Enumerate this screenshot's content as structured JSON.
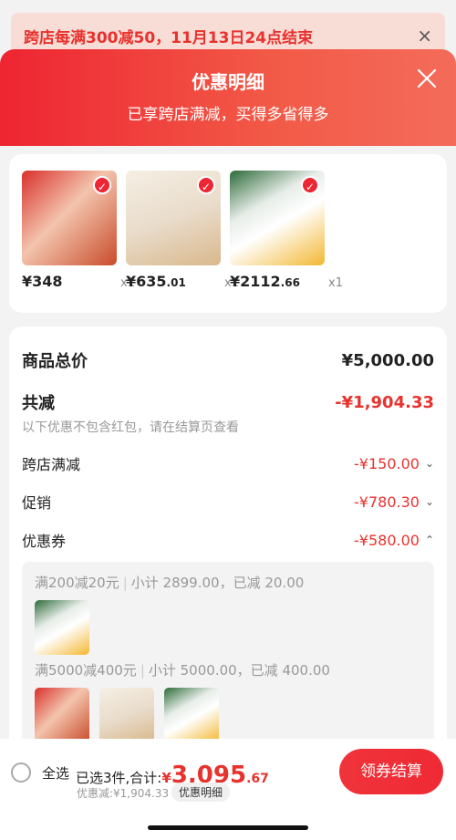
{
  "banner": {
    "text": "跨店每满300减50，11月13日24点结束",
    "close": "×"
  },
  "sheet": {
    "title": "优惠明细",
    "subtitle": "已享跨店满减，买得多省得多"
  },
  "products": [
    {
      "price_int": "¥348",
      "price_dec": "",
      "qty": "x1"
    },
    {
      "price_int": "¥635",
      "price_dec": ".01",
      "qty": "x1"
    },
    {
      "price_int": "¥2112",
      "price_dec": ".66",
      "qty": "x1"
    }
  ],
  "summary": {
    "total_label": "商品总价",
    "total_value": "¥5,000.00",
    "reduce_label": "共减",
    "reduce_value": "-¥1,904.33",
    "note": "以下优惠不包含红包，请在结算页查看",
    "items": [
      {
        "label": "跨店满减",
        "value": "-¥150.00",
        "caret": "⌄"
      },
      {
        "label": "促销",
        "value": "-¥780.30",
        "caret": "⌄"
      },
      {
        "label": "优惠券",
        "value": "-¥580.00",
        "caret": "⌃"
      }
    ]
  },
  "coupons": {
    "tier1": {
      "rule": "满200减20元",
      "detail": "小计 2899.00，已减 20.00"
    },
    "tier2": {
      "rule": "满5000减400元",
      "detail": "小计 5000.00，已减 400.00"
    }
  },
  "bottom": {
    "select_all": "全选",
    "selected_prefix": "已选3件,合计:",
    "total_cur": "¥",
    "total_int": "3,095",
    "total_dec": ".67",
    "discount": "优惠减:¥1,904.33",
    "detail_chip": "优惠明细",
    "checkout": "领券结算"
  },
  "colors": {
    "accent": "#ee2532",
    "red_text": "#e8322e"
  }
}
